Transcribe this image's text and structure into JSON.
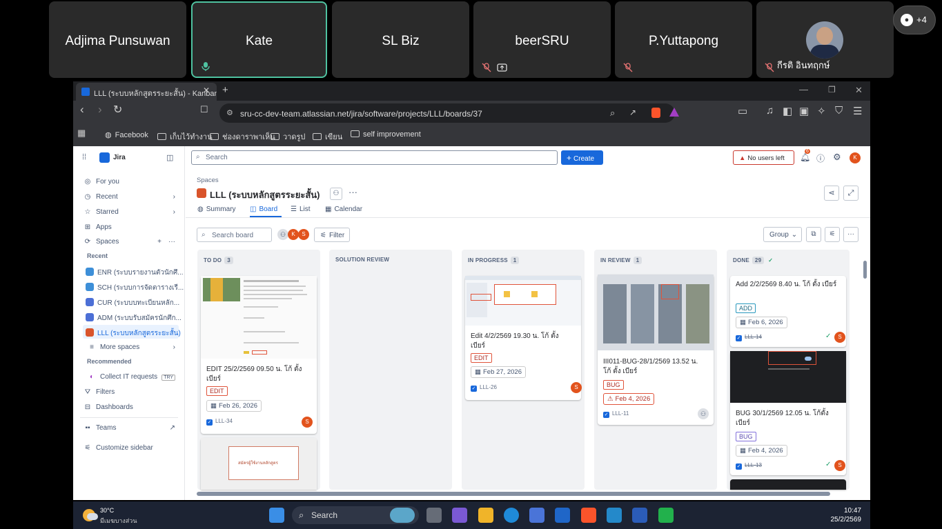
{
  "meeting": {
    "participants": [
      {
        "name": "Adjima Punsuwan"
      },
      {
        "name": "Kate"
      },
      {
        "name": "SL Biz"
      },
      {
        "name": "beerSRU"
      },
      {
        "name": "P.Yuttapong"
      },
      {
        "name": "กีรติ อินทฤกษ์"
      }
    ],
    "more_count": "+4"
  },
  "browser": {
    "tab_title": "LLL (ระบบหลักสูตรระยะสั้น) - Kanban",
    "url": "sru-cc-dev-team.atlassian.net/jira/software/projects/LLL/boards/37",
    "bookmarks": [
      "Facebook",
      "เก็บไว้ทำงาน",
      "ช่องดาราพาเห็น",
      "วาดรูป",
      "เขียน",
      "self improvement"
    ]
  },
  "jira": {
    "app_name": "Jira",
    "search_placeholder": "Search",
    "create_label": "Create",
    "no_users": "No users left",
    "notif_count": "6",
    "avatar_initial": "K",
    "sidebar": {
      "for_you": "For you",
      "recent": "Recent",
      "starred": "Starred",
      "apps": "Apps",
      "spaces": "Spaces",
      "recent_header": "Recent",
      "projects": [
        {
          "name": "ENR (ระบบรายงานตัวนักศึ...",
          "color": "#3d8fd8"
        },
        {
          "name": "SCH (ระบบการจัดตารางเรี...",
          "color": "#3d8fd8"
        },
        {
          "name": "CUR (ระบบบทะเบียนหลัก...",
          "color": "#4c6fd6"
        },
        {
          "name": "ADM (ระบบรับสมัครนักศึก...",
          "color": "#4c6fd6"
        },
        {
          "name": "LLL (ระบบหลักสูตรระยะสั้น)",
          "color": "#d9542b"
        }
      ],
      "more_spaces": "More spaces",
      "recommended": "Recommended",
      "collect_it": "Collect IT requests",
      "try_badge": "TRY",
      "filters": "Filters",
      "dashboards": "Dashboards",
      "teams": "Teams",
      "customize": "Customize sidebar"
    },
    "breadcrumb": "Spaces",
    "project_title": "LLL (ระบบหลักสูตรระยะสั้น)",
    "tabs": [
      "Summary",
      "Board",
      "List",
      "Calendar"
    ],
    "search_board": "Search board",
    "filter_label": "Filter",
    "group_label": "Group",
    "columns": [
      {
        "name": "TO DO",
        "count": "3"
      },
      {
        "name": "SOLUTION REVIEW",
        "count": ""
      },
      {
        "name": "IN PROGRESS",
        "count": "1"
      },
      {
        "name": "IN REVIEW",
        "count": "1"
      },
      {
        "name": "DONE",
        "count": "29"
      }
    ],
    "cards": {
      "todo1": {
        "title": "EDIT 25/2/2569 09.50 น. โก้ ตั้ง เบียร์",
        "label": "EDIT",
        "date": "Feb 26, 2026",
        "key": "LLL-34",
        "avatar": "S"
      },
      "todo2_text": "สมัครผู้ใช้งานหลักสูตร",
      "inprog": {
        "title": "Edit 4/2/2569 19.30 น. โก้ ตั้ง เบียร์",
        "label": "EDIT",
        "date": "Feb 27, 2026",
        "key": "LLL-26",
        "avatar": "S"
      },
      "review": {
        "title": "III011-BUG-28/1/2569 13.52 น. โก้ ตั้ง เบียร์",
        "label": "BUG",
        "date": "Feb 4, 2026",
        "key": "LLL-11"
      },
      "done1": {
        "title": "Add 2/2/2569 8.40 น. โก้ ตั้ง เบียร์",
        "label": "ADD",
        "date": "Feb 6, 2026",
        "key": "LLL-14",
        "avatar": "S"
      },
      "done2": {
        "title": "BUG 30/1/2569 12.05 น. โก้ตั้ง เบียร์",
        "label": "BUG",
        "date": "Feb 4, 2026",
        "key": "LLL-13",
        "avatar": "S"
      }
    }
  },
  "taskbar": {
    "temp": "30°C",
    "weather": "มีเมฆบางส่วน",
    "search": "Search",
    "time": "10:47",
    "date": "25/2/2569"
  },
  "colors": {
    "accent": "#1868db",
    "meeting_active": "#4fc3a1",
    "danger": "#c9372c"
  }
}
